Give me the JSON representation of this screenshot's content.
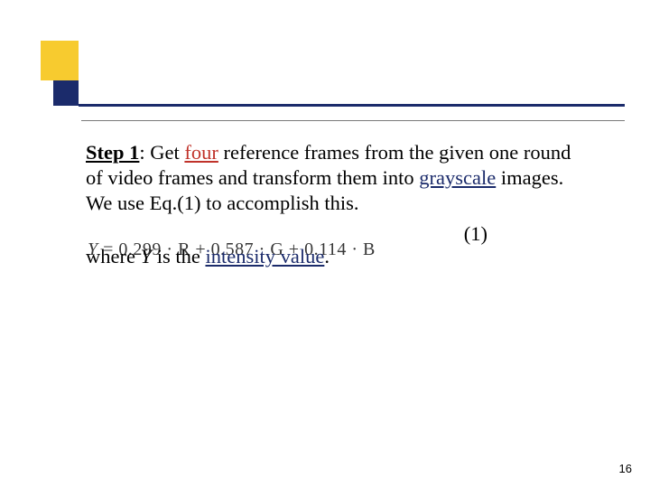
{
  "step": {
    "label": "Step 1",
    "s1": ": Get ",
    "kw_four": "four",
    "s2": " reference frames from the given one round of video frames and transform them into ",
    "kw_grayscale": "grayscale",
    "s3": " images. We use Eq.(1) to accomplish this."
  },
  "equation": {
    "number": "(1)",
    "text_prefix": "Y",
    "text_rest": " = 0.299 · R + 0.587 · G + 0.114 · B"
  },
  "where": {
    "s1": "where ",
    "var": "Y",
    "s2": " is the ",
    "kw_intensity": "intensity value",
    "s3": "."
  },
  "page_number": "16"
}
